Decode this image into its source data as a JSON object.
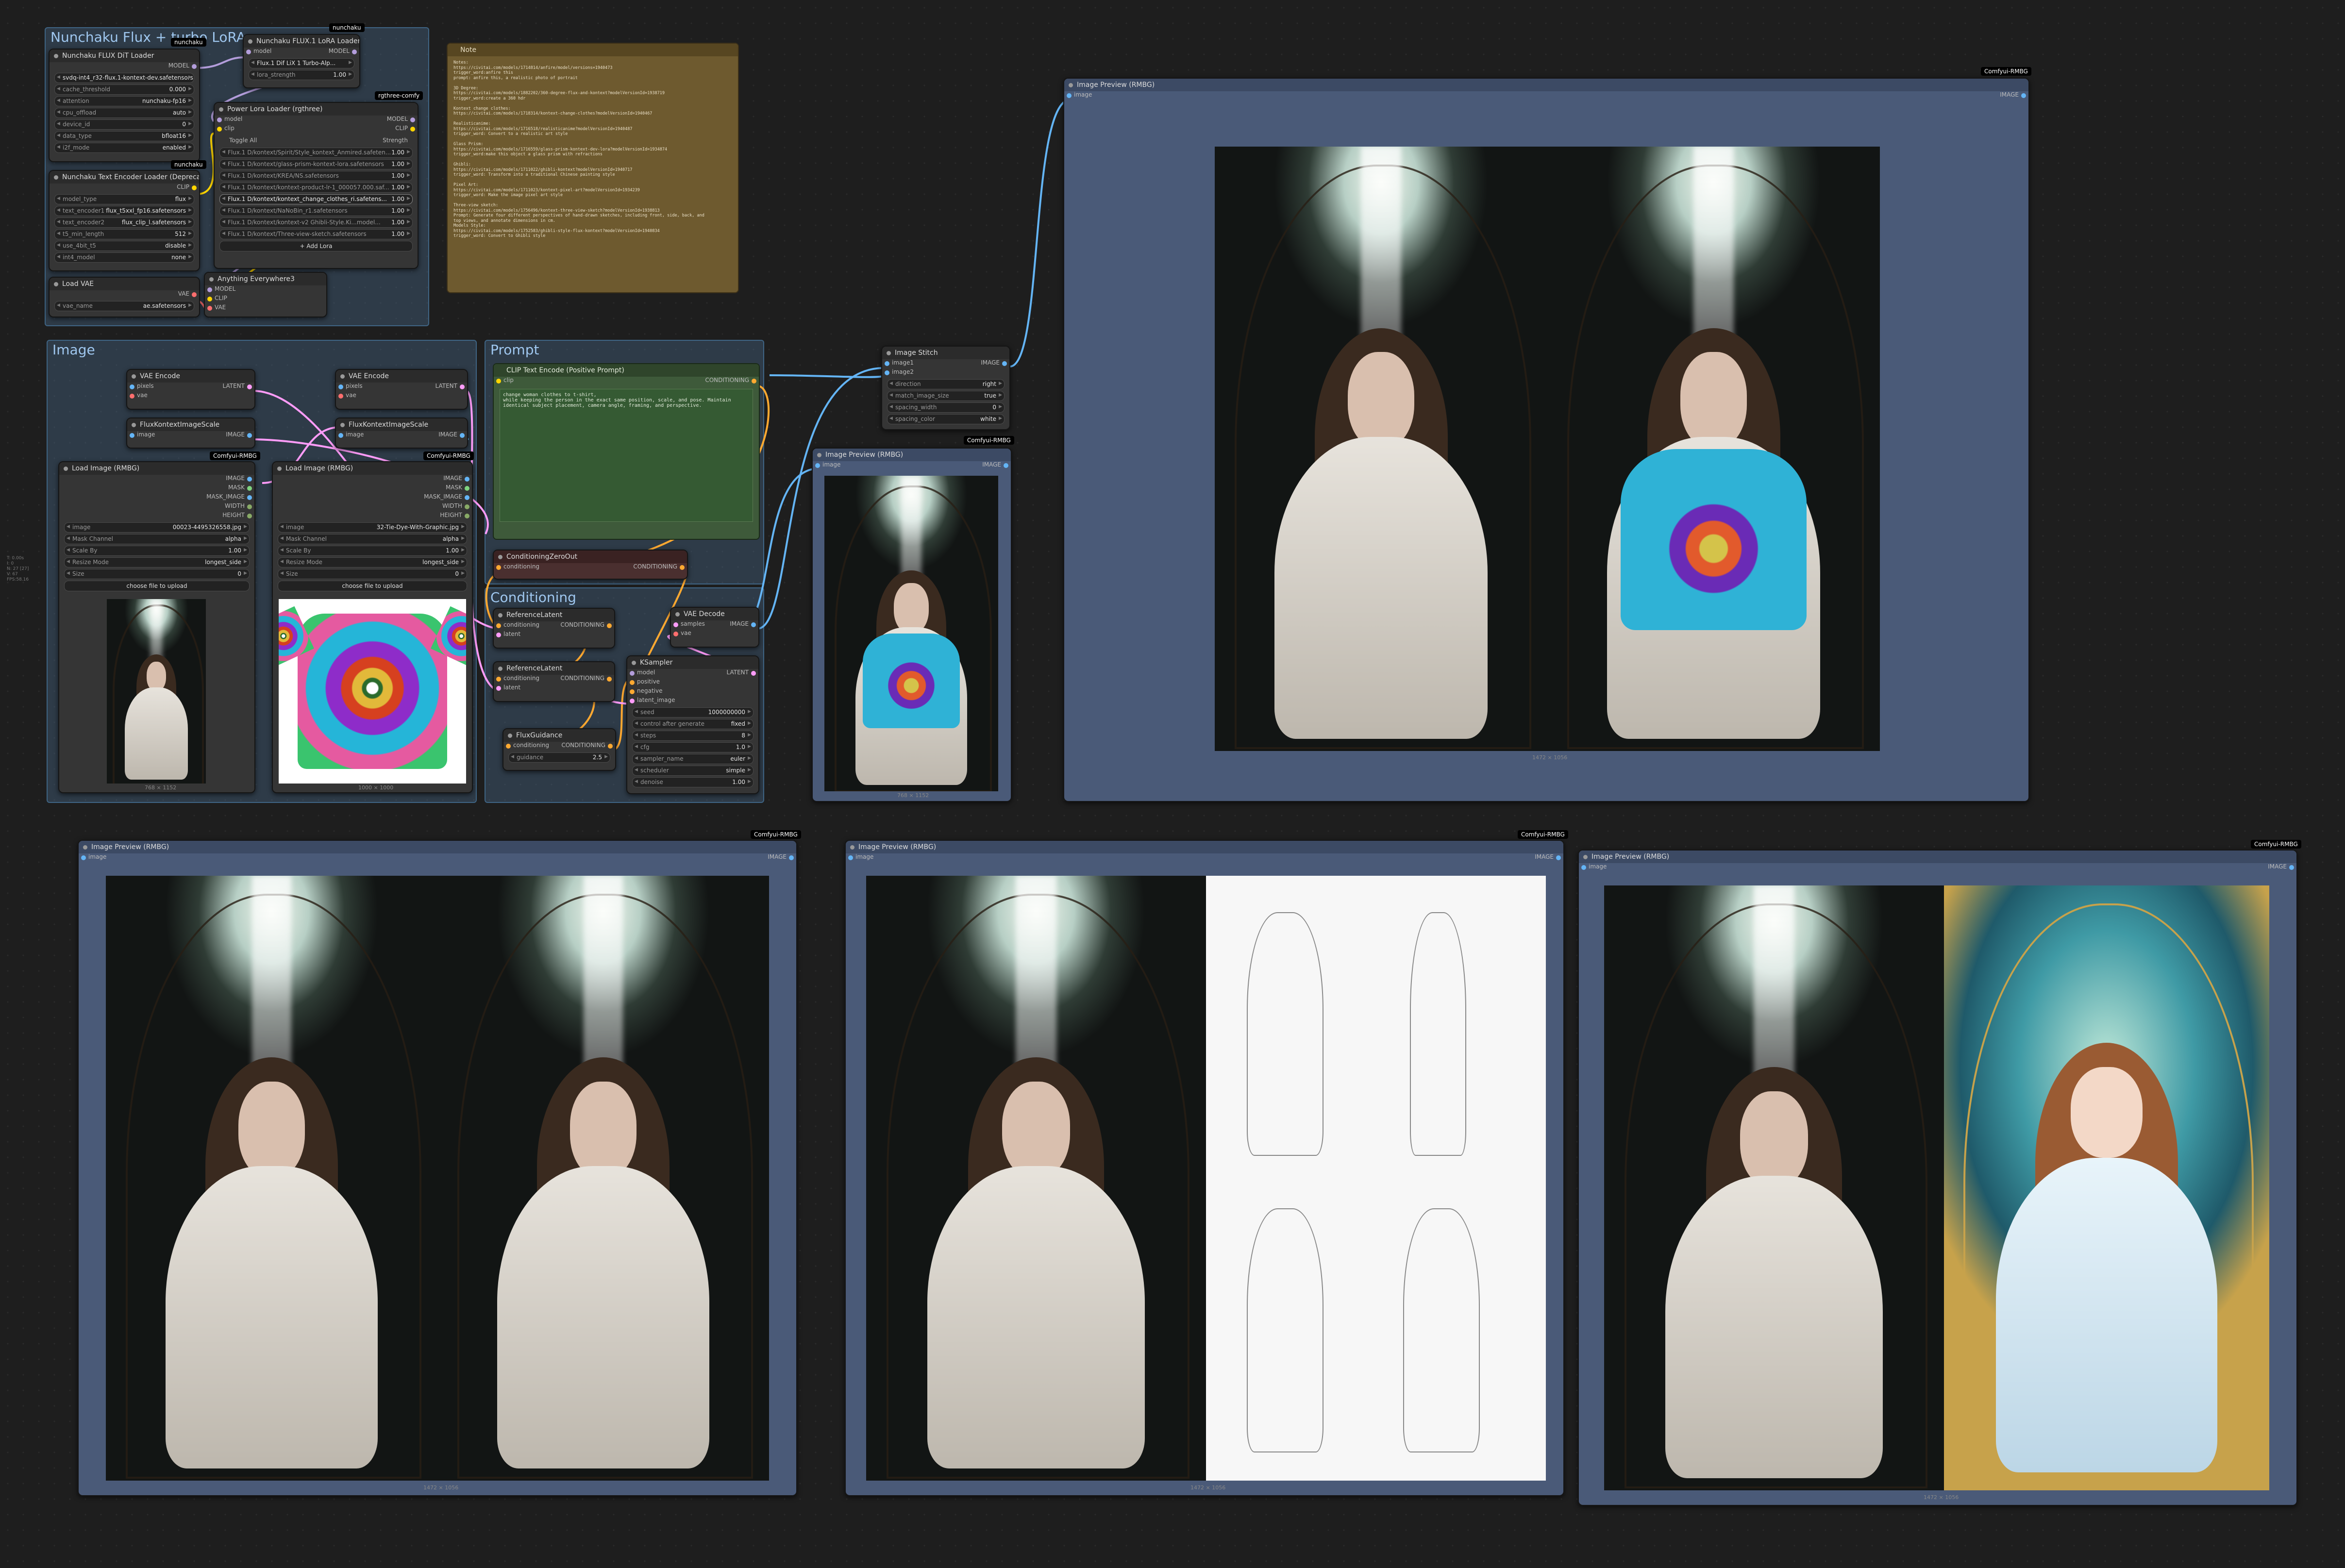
{
  "sidebar_info": [
    "T: 0.00s",
    "I: 0",
    "N: 27 [27]",
    "V: 67",
    "FPS:58.16"
  ],
  "groups": {
    "loaders": "Nunchaku Flux + turbo LoRA",
    "image": "Image",
    "prompt": "Prompt",
    "conditioning": "Conditioning"
  },
  "badges": {
    "nunchaku": "nunchaku",
    "rgthree": "rgthree-comfy",
    "rmbg": "Comfyui-RMBG"
  },
  "dit_loader": {
    "title": "Nunchaku FLUX DiT Loader",
    "out": "MODEL",
    "widgets": [
      {
        "label": "",
        "value": "svdq-int4_r32-flux.1-kontext-dev.safetensors"
      },
      {
        "label": "cache_threshold",
        "value": "0.000"
      },
      {
        "label": "attention",
        "value": "nunchaku-fp16"
      },
      {
        "label": "cpu_offload",
        "value": "auto"
      },
      {
        "label": "device_id",
        "value": "0"
      },
      {
        "label": "data_type",
        "value": "bfloat16"
      },
      {
        "label": "i2f_mode",
        "value": "enabled"
      }
    ]
  },
  "lora_loader": {
    "title": "Nunchaku FLUX.1 LoRA Loader",
    "in": "model",
    "out": "MODEL",
    "widgets": [
      {
        "label": "",
        "value": "Flux.1 Dif LiX 1 Turbo-Alp..."
      },
      {
        "label": "lora_strength",
        "value": "1.00"
      }
    ]
  },
  "power_lora": {
    "title": "Power Lora Loader (rgthree)",
    "inputs": [
      "model",
      "clip"
    ],
    "outputs": [
      "MODEL",
      "CLIP"
    ],
    "toggle_all": "Toggle All",
    "toggle_strength": "Strength",
    "loras": [
      {
        "name": "Flux.1 D/kontext/Spirit/Style_kontext_Anmired.safeten...",
        "strength": "1.00"
      },
      {
        "name": "Flux.1 D/kontext/glass-prism-kontext-lora.safetensors",
        "strength": "1.00"
      },
      {
        "name": "Flux.1 D/kontext/KREA/NS.safetensors",
        "strength": "1.00"
      },
      {
        "name": "Flux.1 D/kontext/kontext-product-lr-1_000057.000.saf...",
        "strength": "1.00"
      },
      {
        "name": "Flux.1 D/kontext/kontext_change_clothes_ri.safetens...",
        "strength": "1.00"
      },
      {
        "name": "Flux.1 D/kontext/NaNoBin_r1.safetensors",
        "strength": "1.00"
      },
      {
        "name": "Flux.1 D/kontext/kontext-v2 Ghibli-Style.Ki...model...",
        "strength": "1.00"
      },
      {
        "name": "Flux.1 D/kontext/Three-view-sketch.safetensors",
        "strength": "1.00"
      }
    ],
    "add_button": "+ Add Lora"
  },
  "text_encoder": {
    "title": "Nunchaku Text Encoder Loader (Deprecated)",
    "out": "CLIP",
    "widgets": [
      {
        "label": "model_type",
        "value": "flux"
      },
      {
        "label": "text_encoder1",
        "value": "flux_t5xxl_fp16.safetensors"
      },
      {
        "label": "text_encoder2",
        "value": "flux_clip_l.safetensors"
      },
      {
        "label": "t5_min_length",
        "value": "512"
      },
      {
        "label": "use_4bit_t5",
        "value": "disable"
      },
      {
        "label": "int4_model",
        "value": "none"
      }
    ]
  },
  "load_vae": {
    "title": "Load VAE",
    "out": "VAE",
    "widgets": [
      {
        "label": "vae_name",
        "value": "ae.safetensors"
      }
    ]
  },
  "anything": {
    "title": "Anything Everywhere3",
    "inputs": [
      "MODEL",
      "CLIP",
      "VAE"
    ]
  },
  "note": {
    "title": "Note",
    "text": "Notes:\nhttps://civitai.com/models/1714814/anfire/model/versions=1940473\ntrigger_word:anfire this\nprompt: anfire this, a realistic photo of portrait\n\n3D Degree:\nhttps://civitai.com/models/1882202/360-degree-flux-and-kontext?modelVersionId=1938719\ntrigger_word:create a 360 hdr\n\nKontext change clothes:\nhttps://civitai.com/models/1718314/kontext-change-clothes?modelVersionId=1940467\n\nRealisticanime:\nhttps://civitai.com/models/1716518/realisticanime?modelVersionId=1940487\ntrigger_word: Convert to a realistic art style\n\nGlass Prism:\nhttps://civitai.com/models/1716559/glass-prism-kontext-dev-lora?modelVersionId=1934874\ntrigger_word:make this object a glass prism with refractions\n\nGhibli:\nhttps://civitai.com/models/1711022/ghibli-kontext?modelVersionId=1940717\ntrigger_word: Transform into a traditional Chinese painting style\n\nPixel Art:\nhttps://civitai.com/models/1711023/kontext-pixel-art?modelVersionId=1934239\ntrigger_word: Make the image pixel art style\n\nThree-view sketch:\nhttps://civitai.com/models/1756496/kontext-three-view-sketch?modelVersionId=1938813\nPrompt: Generate four different perspectives of hand-drawn sketches, including front, side, back, and\ntop views, and annotate dimensions in cm.\nModels Style:\nhttps://civitai.com/models/1752583/ghibli-style-flux-kontext?modelVersionId=1940834\ntrigger_word: Convert to Ghibli style"
  },
  "vae_encode_1": {
    "title": "VAE Encode",
    "inputs": [
      "pixels",
      "vae"
    ],
    "out": "LATENT"
  },
  "vae_encode_2": {
    "title": "VAE Encode",
    "inputs": [
      "pixels",
      "vae"
    ],
    "out": "LATENT"
  },
  "scale_1": {
    "title": "FluxKontextImageScale",
    "in": "image",
    "out": "IMAGE"
  },
  "scale_2": {
    "title": "FluxKontextImageScale",
    "in": "image",
    "out": "IMAGE"
  },
  "load_image_1": {
    "title": "Load Image (RMBG)",
    "outputs": [
      "IMAGE",
      "MASK",
      "MASK_IMAGE",
      "WIDTH",
      "HEIGHT"
    ],
    "widgets": [
      {
        "label": "image",
        "value": "00023-4495326558.jpg"
      },
      {
        "label": "Mask Channel",
        "value": "alpha"
      },
      {
        "label": "Scale By",
        "value": "1.00"
      },
      {
        "label": "Resize Mode",
        "value": "longest_side"
      },
      {
        "label": "Size",
        "value": "0"
      }
    ],
    "upload": "choose file to upload",
    "caption": "768 × 1152"
  },
  "load_image_2": {
    "title": "Load Image (RMBG)",
    "outputs": [
      "IMAGE",
      "MASK",
      "MASK_IMAGE",
      "WIDTH",
      "HEIGHT"
    ],
    "widgets": [
      {
        "label": "image",
        "value": "32-Tie-Dye-With-Graphic.jpg"
      },
      {
        "label": "Mask Channel",
        "value": "alpha"
      },
      {
        "label": "Scale By",
        "value": "1.00"
      },
      {
        "label": "Resize Mode",
        "value": "longest_side"
      },
      {
        "label": "Size",
        "value": "0"
      }
    ],
    "upload": "choose file to upload",
    "caption": "1000 × 1000"
  },
  "clip_text": {
    "title": "CLIP Text Encode (Positive Prompt)",
    "in": "clip",
    "out": "CONDITIONING",
    "text": "change woman clothes to t-shirt,\nwhile keeping the person in the exact same position, scale, and pose. Maintain identical subject placement, camera angle, framing, and perspective."
  },
  "cond_zero": {
    "title": "ConditioningZeroOut",
    "in": "conditioning",
    "out": "CONDITIONING"
  },
  "ref_latent_1": {
    "title": "ReferenceLatent",
    "inputs": [
      "conditioning",
      "latent"
    ],
    "out": "CONDITIONING"
  },
  "ref_latent_2": {
    "title": "ReferenceLatent",
    "inputs": [
      "conditioning",
      "latent"
    ],
    "out": "CONDITIONING"
  },
  "flux_guidance": {
    "title": "FluxGuidance",
    "in": "conditioning",
    "out": "CONDITIONING",
    "widgets": [
      {
        "label": "guidance",
        "value": "2.5"
      }
    ]
  },
  "vae_decode": {
    "title": "VAE Decode",
    "inputs": [
      "samples",
      "vae"
    ],
    "out": "IMAGE"
  },
  "ksampler": {
    "title": "KSampler",
    "inputs": [
      "model",
      "positive",
      "negative",
      "latent_image"
    ],
    "out": "LATENT",
    "widgets": [
      {
        "label": "seed",
        "value": "1000000000"
      },
      {
        "label": "control after generate",
        "value": "fixed"
      },
      {
        "label": "steps",
        "value": "8"
      },
      {
        "label": "cfg",
        "value": "1.0"
      },
      {
        "label": "sampler_name",
        "value": "euler"
      },
      {
        "label": "scheduler",
        "value": "simple"
      },
      {
        "label": "denoise",
        "value": "1.00"
      }
    ]
  },
  "stitch": {
    "title": "Image Stitch",
    "inputs": [
      "image1",
      "image2"
    ],
    "out": "IMAGE",
    "widgets": [
      {
        "label": "direction",
        "value": "right"
      },
      {
        "label": "match_image_size",
        "value": "true"
      },
      {
        "label": "spacing_width",
        "value": "0"
      },
      {
        "label": "spacing_color",
        "value": "white"
      }
    ]
  },
  "preview_small": {
    "title": "Image Preview (RMBG)",
    "in": "image",
    "out": "IMAGE",
    "caption": "768 × 1152"
  },
  "preview_big": {
    "title": "Image Preview (RMBG)",
    "in": "image",
    "out": "IMAGE",
    "caption": "1472 × 1056"
  },
  "preview_b1": {
    "title": "Image Preview (RMBG)",
    "in": "image",
    "out": "IMAGE",
    "caption": "1472 × 1056"
  },
  "preview_b2": {
    "title": "Image Preview (RMBG)",
    "in": "image",
    "out": "IMAGE",
    "caption": "1472 × 1056"
  },
  "preview_b3": {
    "title": "Image Preview (RMBG)",
    "in": "image",
    "out": "IMAGE",
    "caption": "1472 × 1056"
  },
  "colors": {
    "canvas": "#1e1e1e",
    "group": "#3f6585",
    "link_model": "#b39ddb",
    "link_clip": "#ffd500",
    "link_vae": "#ff6e6e",
    "link_image": "#64b5f6",
    "link_latent": "#ff9cf9",
    "link_cond": "#ffa931"
  }
}
